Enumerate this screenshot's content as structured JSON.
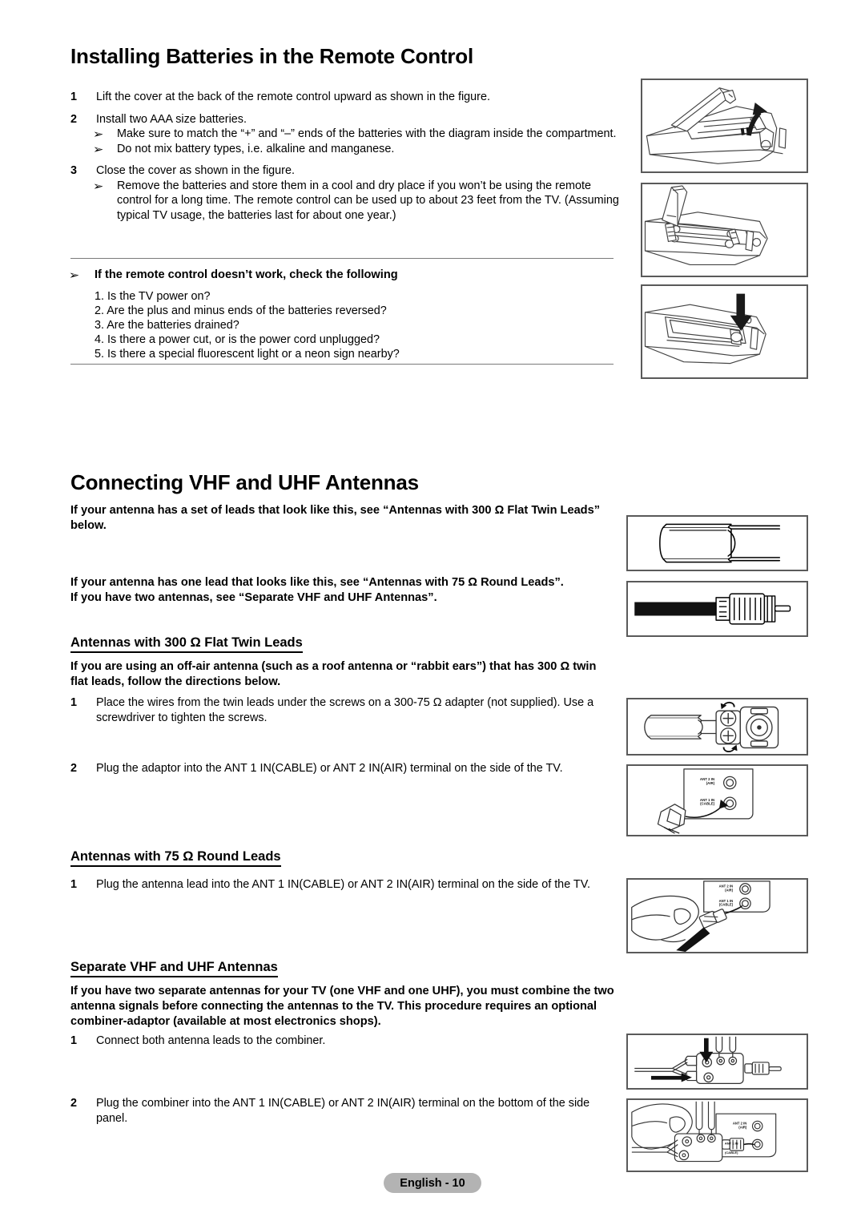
{
  "document": {
    "footer_label": "English - 10"
  },
  "section1": {
    "title": "Installing Batteries in the Remote Control",
    "steps": [
      {
        "num": "1",
        "text": "Lift the cover at the back of the remote control upward as shown in the figure.",
        "bullets": []
      },
      {
        "num": "2",
        "text": "Install two AAA size batteries.",
        "bullets": [
          "Make sure to match the “+” and “–” ends of the batteries with the diagram inside the compartment.",
          "Do not mix battery types, i.e. alkaline and manganese."
        ]
      },
      {
        "num": "3",
        "text": "Close the cover as shown in the figure.",
        "bullets": [
          "Remove the batteries and store them in a cool and dry place if you won’t be using the remote control for a long time. The remote control can be used up to about 23 feet from the TV. (Assuming typical TV usage, the batteries last for about one year.)"
        ]
      }
    ],
    "troubleshoot": {
      "heading": "If the remote control doesn’t work, check the following",
      "items": [
        "1. Is the TV power on?",
        "2. Are the plus and minus ends of the batteries reversed?",
        "3. Are the batteries drained?",
        "4. Is there a power cut, or is the power cord unplugged?",
        "5. Is there a special fluorescent light or a neon sign nearby?"
      ]
    }
  },
  "section2": {
    "title": "Connecting VHF and UHF Antennas",
    "intro1": "If your antenna has a set of leads that look like this, see “Antennas with 300 Ω Flat Twin Leads” below.",
    "intro2_line1": "If your antenna has one lead that looks like this, see “Antennas with 75 Ω Round Leads”.",
    "intro2_line2": "If you have two antennas, see “Separate VHF and UHF Antennas”.",
    "sub_flat": {
      "heading": "Antennas with 300 Ω Flat Twin Leads",
      "intro": "If you are using an off-air antenna (such as a roof antenna or “rabbit ears”) that has 300 Ω twin flat leads, follow the directions below.",
      "steps": [
        {
          "num": "1",
          "text": "Place the wires from the twin leads under the screws on a 300-75 Ω adapter (not supplied). Use a screwdriver to tighten the screws."
        },
        {
          "num": "2",
          "text": "Plug the adaptor into the ANT 1 IN(CABLE) or ANT 2 IN(AIR) terminal on the side of the TV."
        }
      ]
    },
    "sub_round": {
      "heading": "Antennas with 75 Ω Round Leads",
      "steps": [
        {
          "num": "1",
          "text": "Plug the antenna lead into the ANT 1 IN(CABLE) or ANT 2 IN(AIR) terminal on the side of the TV."
        }
      ]
    },
    "sub_separate": {
      "heading": "Separate VHF and UHF Antennas",
      "intro": "If you have two separate antennas for your TV (one VHF and one UHF), you must combine the two antenna signals before connecting the antennas to the TV. This procedure requires an optional combiner-adaptor (available at most electronics shops).",
      "steps": [
        {
          "num": "1",
          "text": "Connect both antenna leads to the combiner."
        },
        {
          "num": "2",
          "text": "Plug the combiner into the ANT 1 IN(CABLE) or ANT 2 IN(AIR) terminal on the bottom of the side panel."
        }
      ]
    }
  },
  "figures": {
    "fig_remote_open": "remote-cover-lift-illustration",
    "fig_remote_batteries": "remote-batteries-inserted-illustration",
    "fig_remote_close": "remote-cover-close-illustration",
    "fig_flat_twin_lead": "flat-twin-lead-cable-illustration",
    "fig_round_coax_lead": "round-coax-lead-illustration",
    "fig_adapter_screws": "300-75-ohm-adapter-illustration",
    "fig_adapter_to_tv": "adapter-into-tv-terminal-illustration",
    "fig_coax_to_tv": "coax-into-tv-terminal-illustration",
    "fig_combiner": "antenna-combiner-illustration",
    "fig_combiner_to_tv": "combiner-into-tv-terminal-illustration",
    "port_labels": {
      "ant2_line1": "ANT 2 IN",
      "ant2_line2": "(AIR)",
      "ant1_line1": "ANT 1 IN",
      "ant1_line2": "(CABLE)"
    }
  },
  "bullet_glyph": "➢"
}
